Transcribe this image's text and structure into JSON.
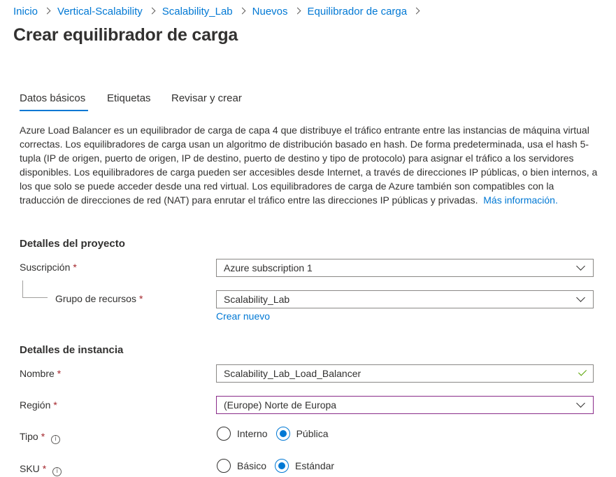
{
  "breadcrumb": {
    "items": [
      "Inicio",
      "Vertical-Scalability",
      "Scalability_Lab",
      "Nuevos",
      "Equilibrador de carga"
    ]
  },
  "page": {
    "title": "Crear equilibrador de carga"
  },
  "tabs": [
    {
      "label": "Datos básicos",
      "active": true
    },
    {
      "label": "Etiquetas",
      "active": false
    },
    {
      "label": "Revisar y crear",
      "active": false
    }
  ],
  "description": {
    "text": "Azure Load Balancer es un equilibrador de carga de capa 4 que distribuye el tráfico entrante entre las instancias de máquina virtual correctas. Los equilibradores de carga usan un algoritmo de distribución basado en hash. De forma predeterminada, usa el hash 5-tupla (IP de origen, puerto de origen, IP de destino, puerto de destino y tipo de protocolo) para asignar el tráfico a los servidores disponibles. Los equilibradores de carga pueden ser accesibles desde Internet, a través de direcciones IP públicas, o bien internos, a los que solo se puede acceder desde una red virtual. Los equilibradores de carga de Azure también son compatibles con la traducción de direcciones de red (NAT) para enrutar el tráfico entre las direcciones IP públicas y privadas.",
    "link": "Más información."
  },
  "project": {
    "title": "Detalles del proyecto",
    "subscription": {
      "label": "Suscripción",
      "value": "Azure subscription 1"
    },
    "resource_group": {
      "label": "Grupo de recursos",
      "value": "Scalability_Lab",
      "create_new": "Crear nuevo"
    }
  },
  "instance": {
    "title": "Detalles de instancia",
    "name": {
      "label": "Nombre",
      "value": "Scalability_Lab_Load_Balancer"
    },
    "region": {
      "label": "Región",
      "value": "(Europe) Norte de Europa"
    },
    "type": {
      "label": "Tipo",
      "options": [
        "Interno",
        "Pública"
      ],
      "selected": "Pública"
    },
    "sku": {
      "label": "SKU",
      "options": [
        "Básico",
        "Estándar"
      ],
      "selected": "Estándar"
    }
  },
  "common": {
    "required_mark": "*",
    "info_glyph": "i"
  },
  "colors": {
    "accent": "#0078d4",
    "required": "#a4262c",
    "valid": "#57a300",
    "focus": "#8a2c8a"
  },
  "icons": [
    "chevron-right-icon",
    "chevron-down-icon",
    "checkmark-icon",
    "info-icon"
  ]
}
